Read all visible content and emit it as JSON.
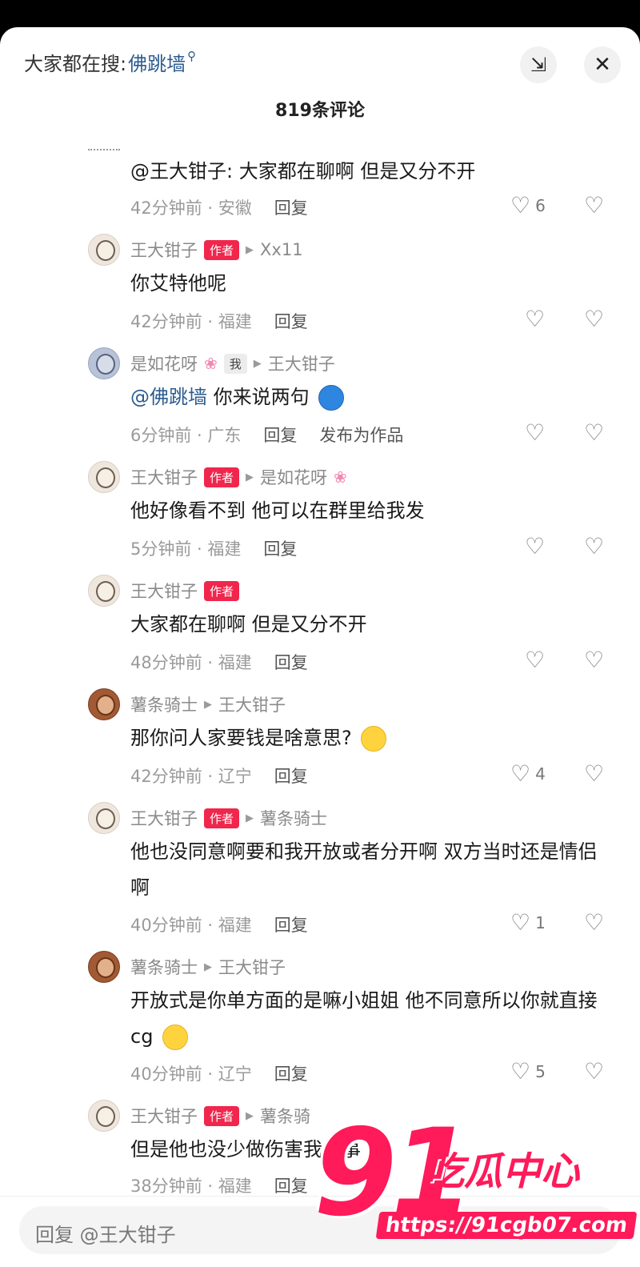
{
  "header": {
    "search_prefix": "大家都在搜:",
    "search_keyword": "佛跳墙",
    "comment_count_title": "819条评论"
  },
  "comments": [
    {
      "text": "@王大钳子: 大家都在聊啊 但是又分不开",
      "time_location": "42分钟前 · 安徽",
      "reply_label": "回复",
      "likes": "6"
    },
    {
      "username": "王大钳子",
      "tag": "作者",
      "reply_to": "Xx11",
      "text": "你艾特他呢",
      "time_location": "42分钟前 · 福建",
      "reply_label": "回复"
    },
    {
      "username": "是如花呀",
      "tag": "我",
      "reply_to": "王大钳子",
      "mention": "@佛跳墙",
      "text": "你来说两句",
      "time_location": "6分钟前 · 广东",
      "reply_label": "回复",
      "publish_label": "发布为作品"
    },
    {
      "username": "王大钳子",
      "tag": "作者",
      "reply_to": "是如花呀",
      "text": "他好像看不到 他可以在群里给我发",
      "time_location": "5分钟前 · 福建",
      "reply_label": "回复"
    },
    {
      "username": "王大钳子",
      "tag": "作者",
      "text": "大家都在聊啊 但是又分不开",
      "time_location": "48分钟前 · 福建",
      "reply_label": "回复"
    },
    {
      "username": "薯条骑士",
      "reply_to": "王大钳子",
      "text": "那你问人家要钱是啥意思?",
      "time_location": "42分钟前 · 辽宁",
      "reply_label": "回复",
      "likes": "4"
    },
    {
      "username": "王大钳子",
      "tag": "作者",
      "reply_to": "薯条骑士",
      "text": "他也没同意啊要和我开放或者分开啊 双方当时还是情侣啊",
      "time_location": "40分钟前 · 福建",
      "reply_label": "回复",
      "likes": "1"
    },
    {
      "username": "薯条骑士",
      "reply_to": "王大钳子",
      "text": "开放式是你单方面的是嘛小姐姐 他不同意所以你就直接cg",
      "time_location": "40分钟前 · 辽宁",
      "reply_label": "回复",
      "likes": "5"
    },
    {
      "username": "王大钳子",
      "tag": "作者",
      "reply_to": "薯条骑",
      "text": "但是他也没少做伤害我的事",
      "time_location": "38分钟前 · 福建",
      "reply_label": "回复"
    }
  ],
  "input": {
    "placeholder": "回复 @王大钳子"
  },
  "watermark": {
    "number": "91",
    "brand": "吃瓜中心",
    "url": "https://91cgb07.com"
  },
  "colors": {
    "author_tag": "#f0264c",
    "mention": "#2c5b8f",
    "watermark": "#ff1a5a"
  },
  "icons": [
    "collapse-icon",
    "close-icon",
    "heart-icon",
    "broken-heart-icon",
    "image-icon",
    "at-icon",
    "smile-icon"
  ]
}
